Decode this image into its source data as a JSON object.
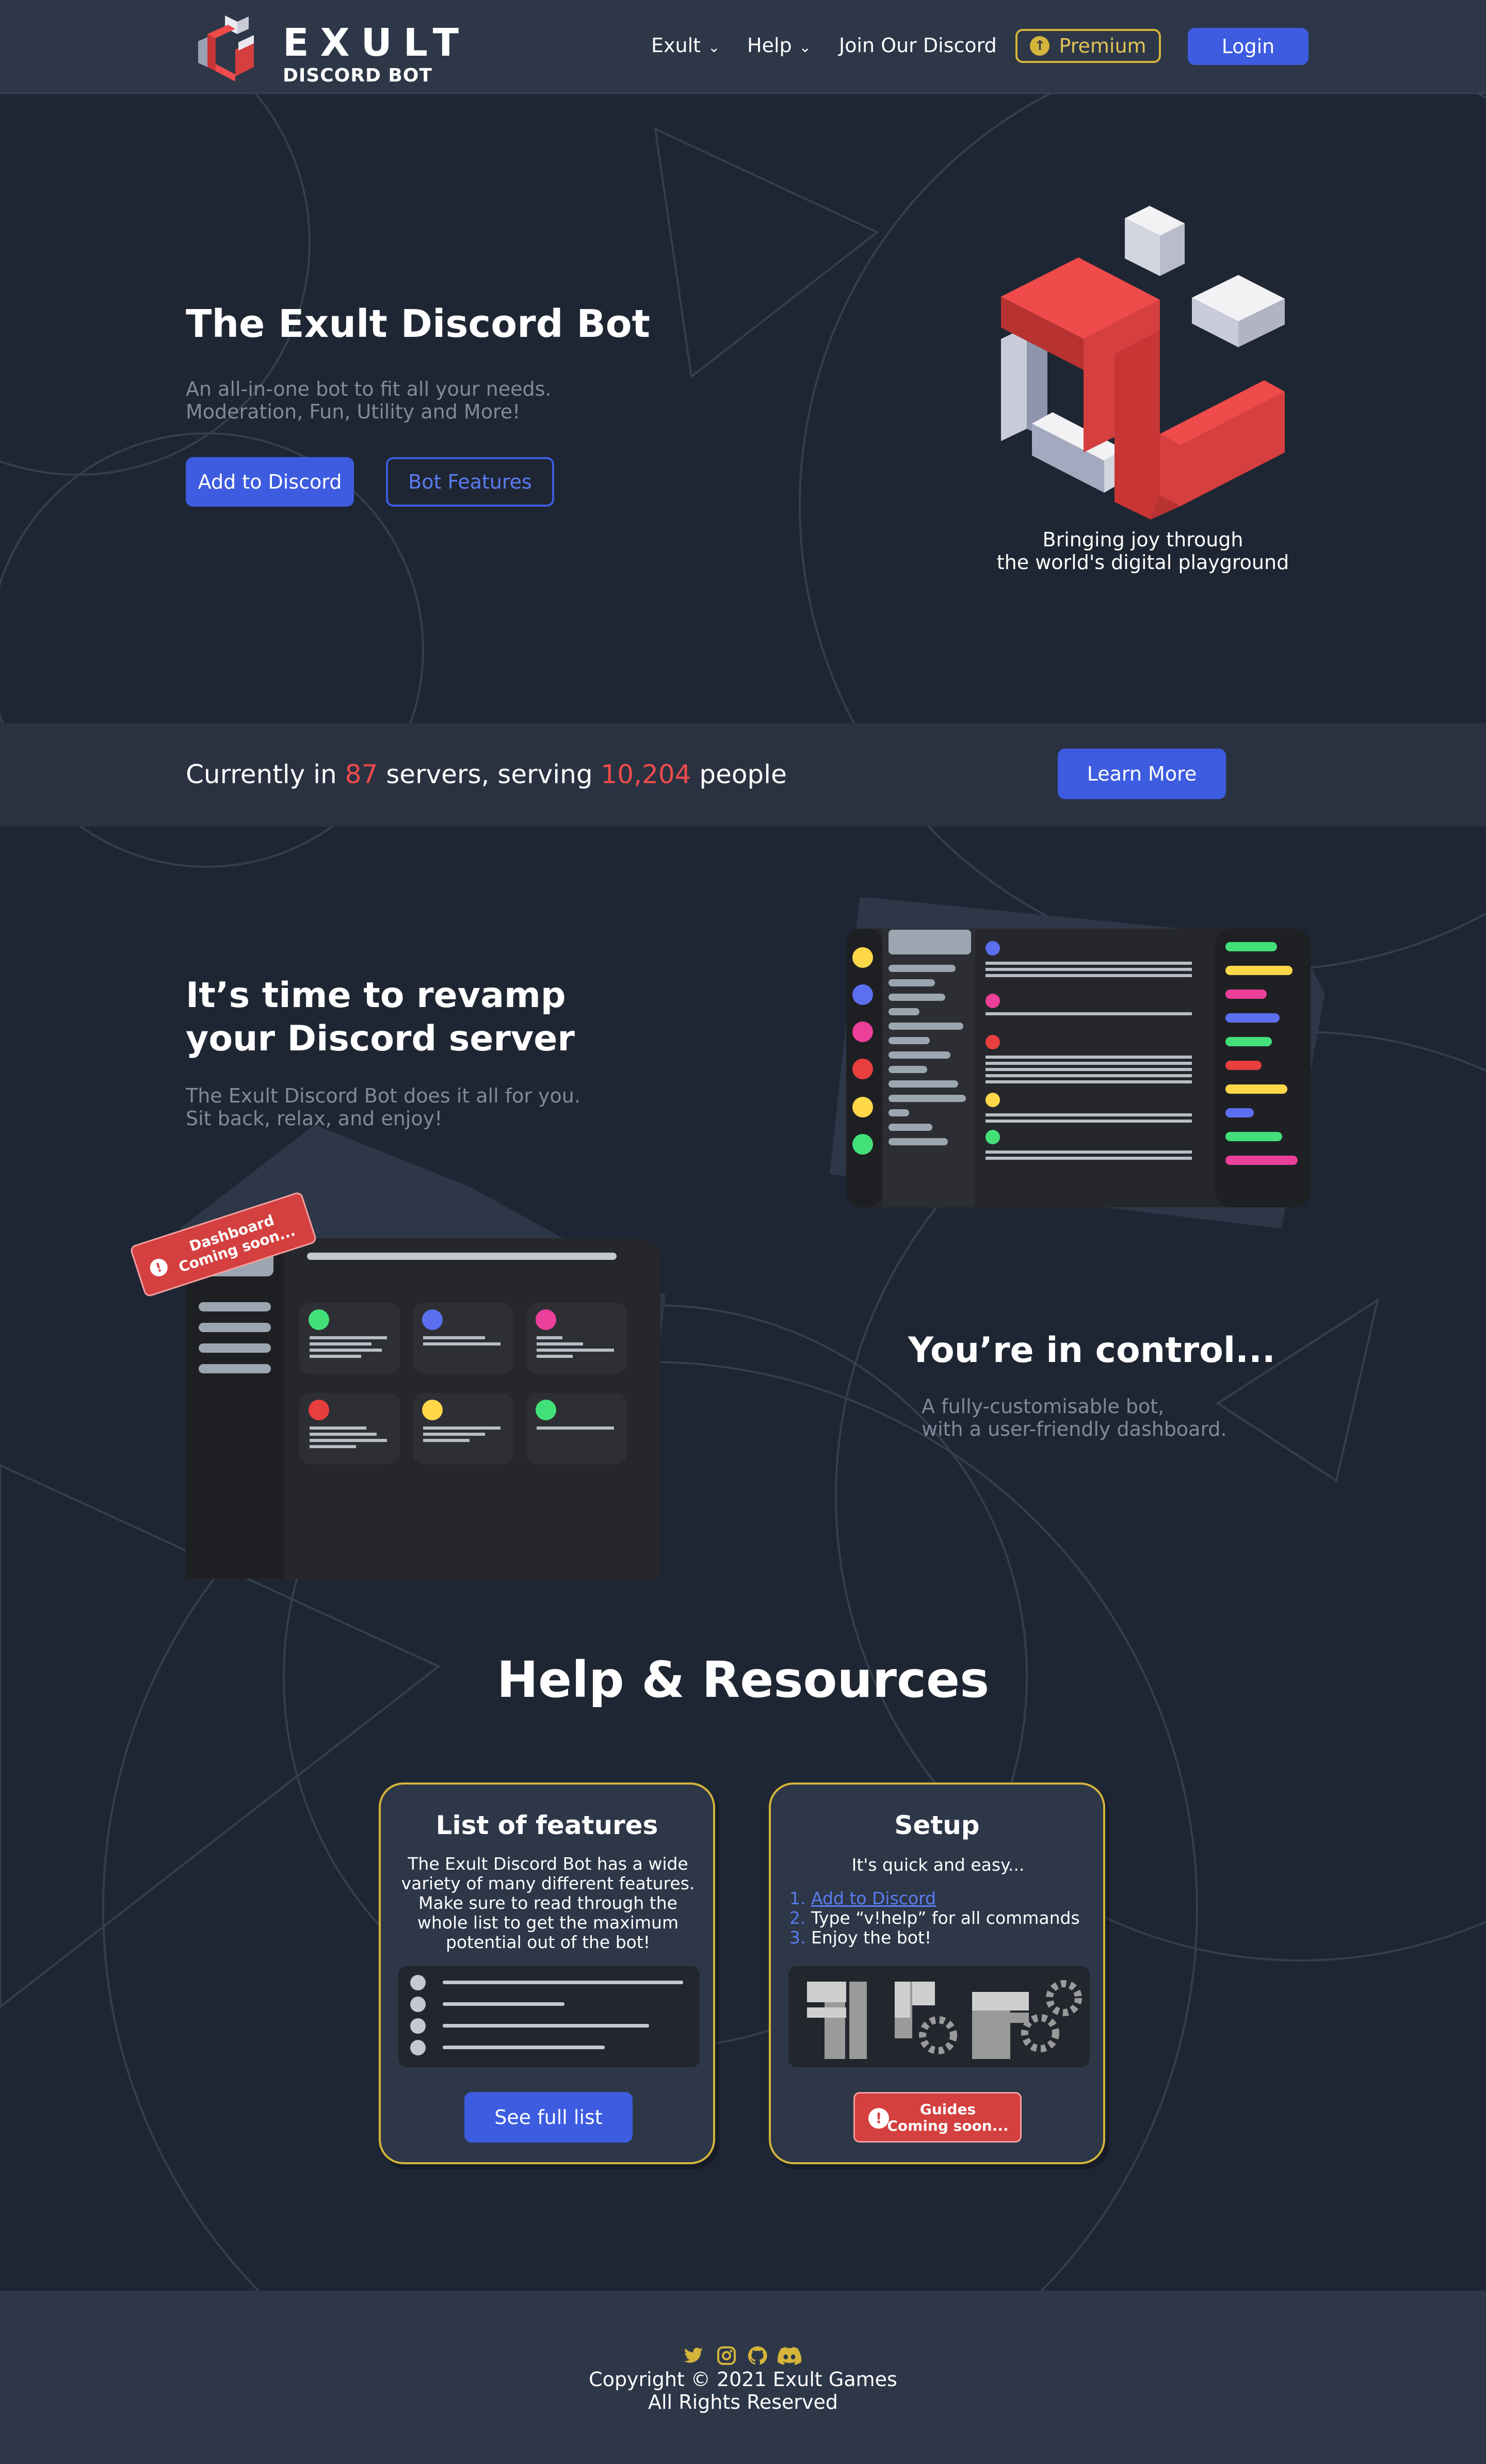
{
  "nav": {
    "brand_name": "EXULT",
    "brand_sub": "DISCORD BOT",
    "links": [
      {
        "label": "Exult",
        "has_dropdown": true
      },
      {
        "label": "Help",
        "has_dropdown": true
      },
      {
        "label": "Join Our Discord",
        "has_dropdown": false
      }
    ],
    "premium_label": "Premium",
    "login_label": "Login"
  },
  "hero": {
    "title": "The Exult Discord Bot",
    "subtitle_line1": "An all-in-one bot to fit all your needs.",
    "subtitle_line2": "Moderation, Fun, Utility and More!",
    "add_button": "Add to Discord",
    "features_button": "Bot Features",
    "tagline_line1": "Bringing joy through",
    "tagline_line2": "the world's digital playground"
  },
  "stats": {
    "prefix": "Currently in",
    "servers": "87",
    "middle": "servers, serving",
    "people": "10,204",
    "suffix": "people",
    "button": "Learn More"
  },
  "revamp": {
    "title_line1": "It’s time to revamp",
    "title_line2": "your Discord server",
    "text_line1": "The Exult Discord Bot does it all for you.",
    "text_line2": "Sit back, relax, and enjoy!"
  },
  "control": {
    "title": "You’re in control...",
    "text_line1": "A fully-customisable bot,",
    "text_line2": "with a user-friendly dashboard.",
    "badge_line1": "Dashboard",
    "badge_line2": "Coming soon..."
  },
  "help": {
    "title": "Help & Resources",
    "features_card": {
      "title": "List of features",
      "text": "The Exult Discord Bot has a wide variety of many different features. Make sure to read through the whole list to get the maximum potential out of the bot!",
      "button": "See full list"
    },
    "setup_card": {
      "title": "Setup",
      "intro": "It's quick and easy...",
      "steps": [
        {
          "num": "1.",
          "text": "Add to Discord",
          "is_link": true
        },
        {
          "num": "2.",
          "text": "Type “v!help” for all commands",
          "is_link": false
        },
        {
          "num": "3.",
          "text": "Enjoy the bot!",
          "is_link": false
        }
      ],
      "badge_line1": "Guides",
      "badge_line2": "Coming soon..."
    }
  },
  "footer": {
    "social_icons": [
      "twitter-icon",
      "instagram-icon",
      "github-icon",
      "discord-icon"
    ],
    "copyright": "Copyright © 2021 Exult Games",
    "rights": "All Rights Reserved"
  },
  "colors": {
    "background": "#1f2633",
    "nav": "#2d3748",
    "accent_blue": "#3d5ce0",
    "accent_red": "#ef4b4b",
    "gold": "#d4b43a"
  }
}
